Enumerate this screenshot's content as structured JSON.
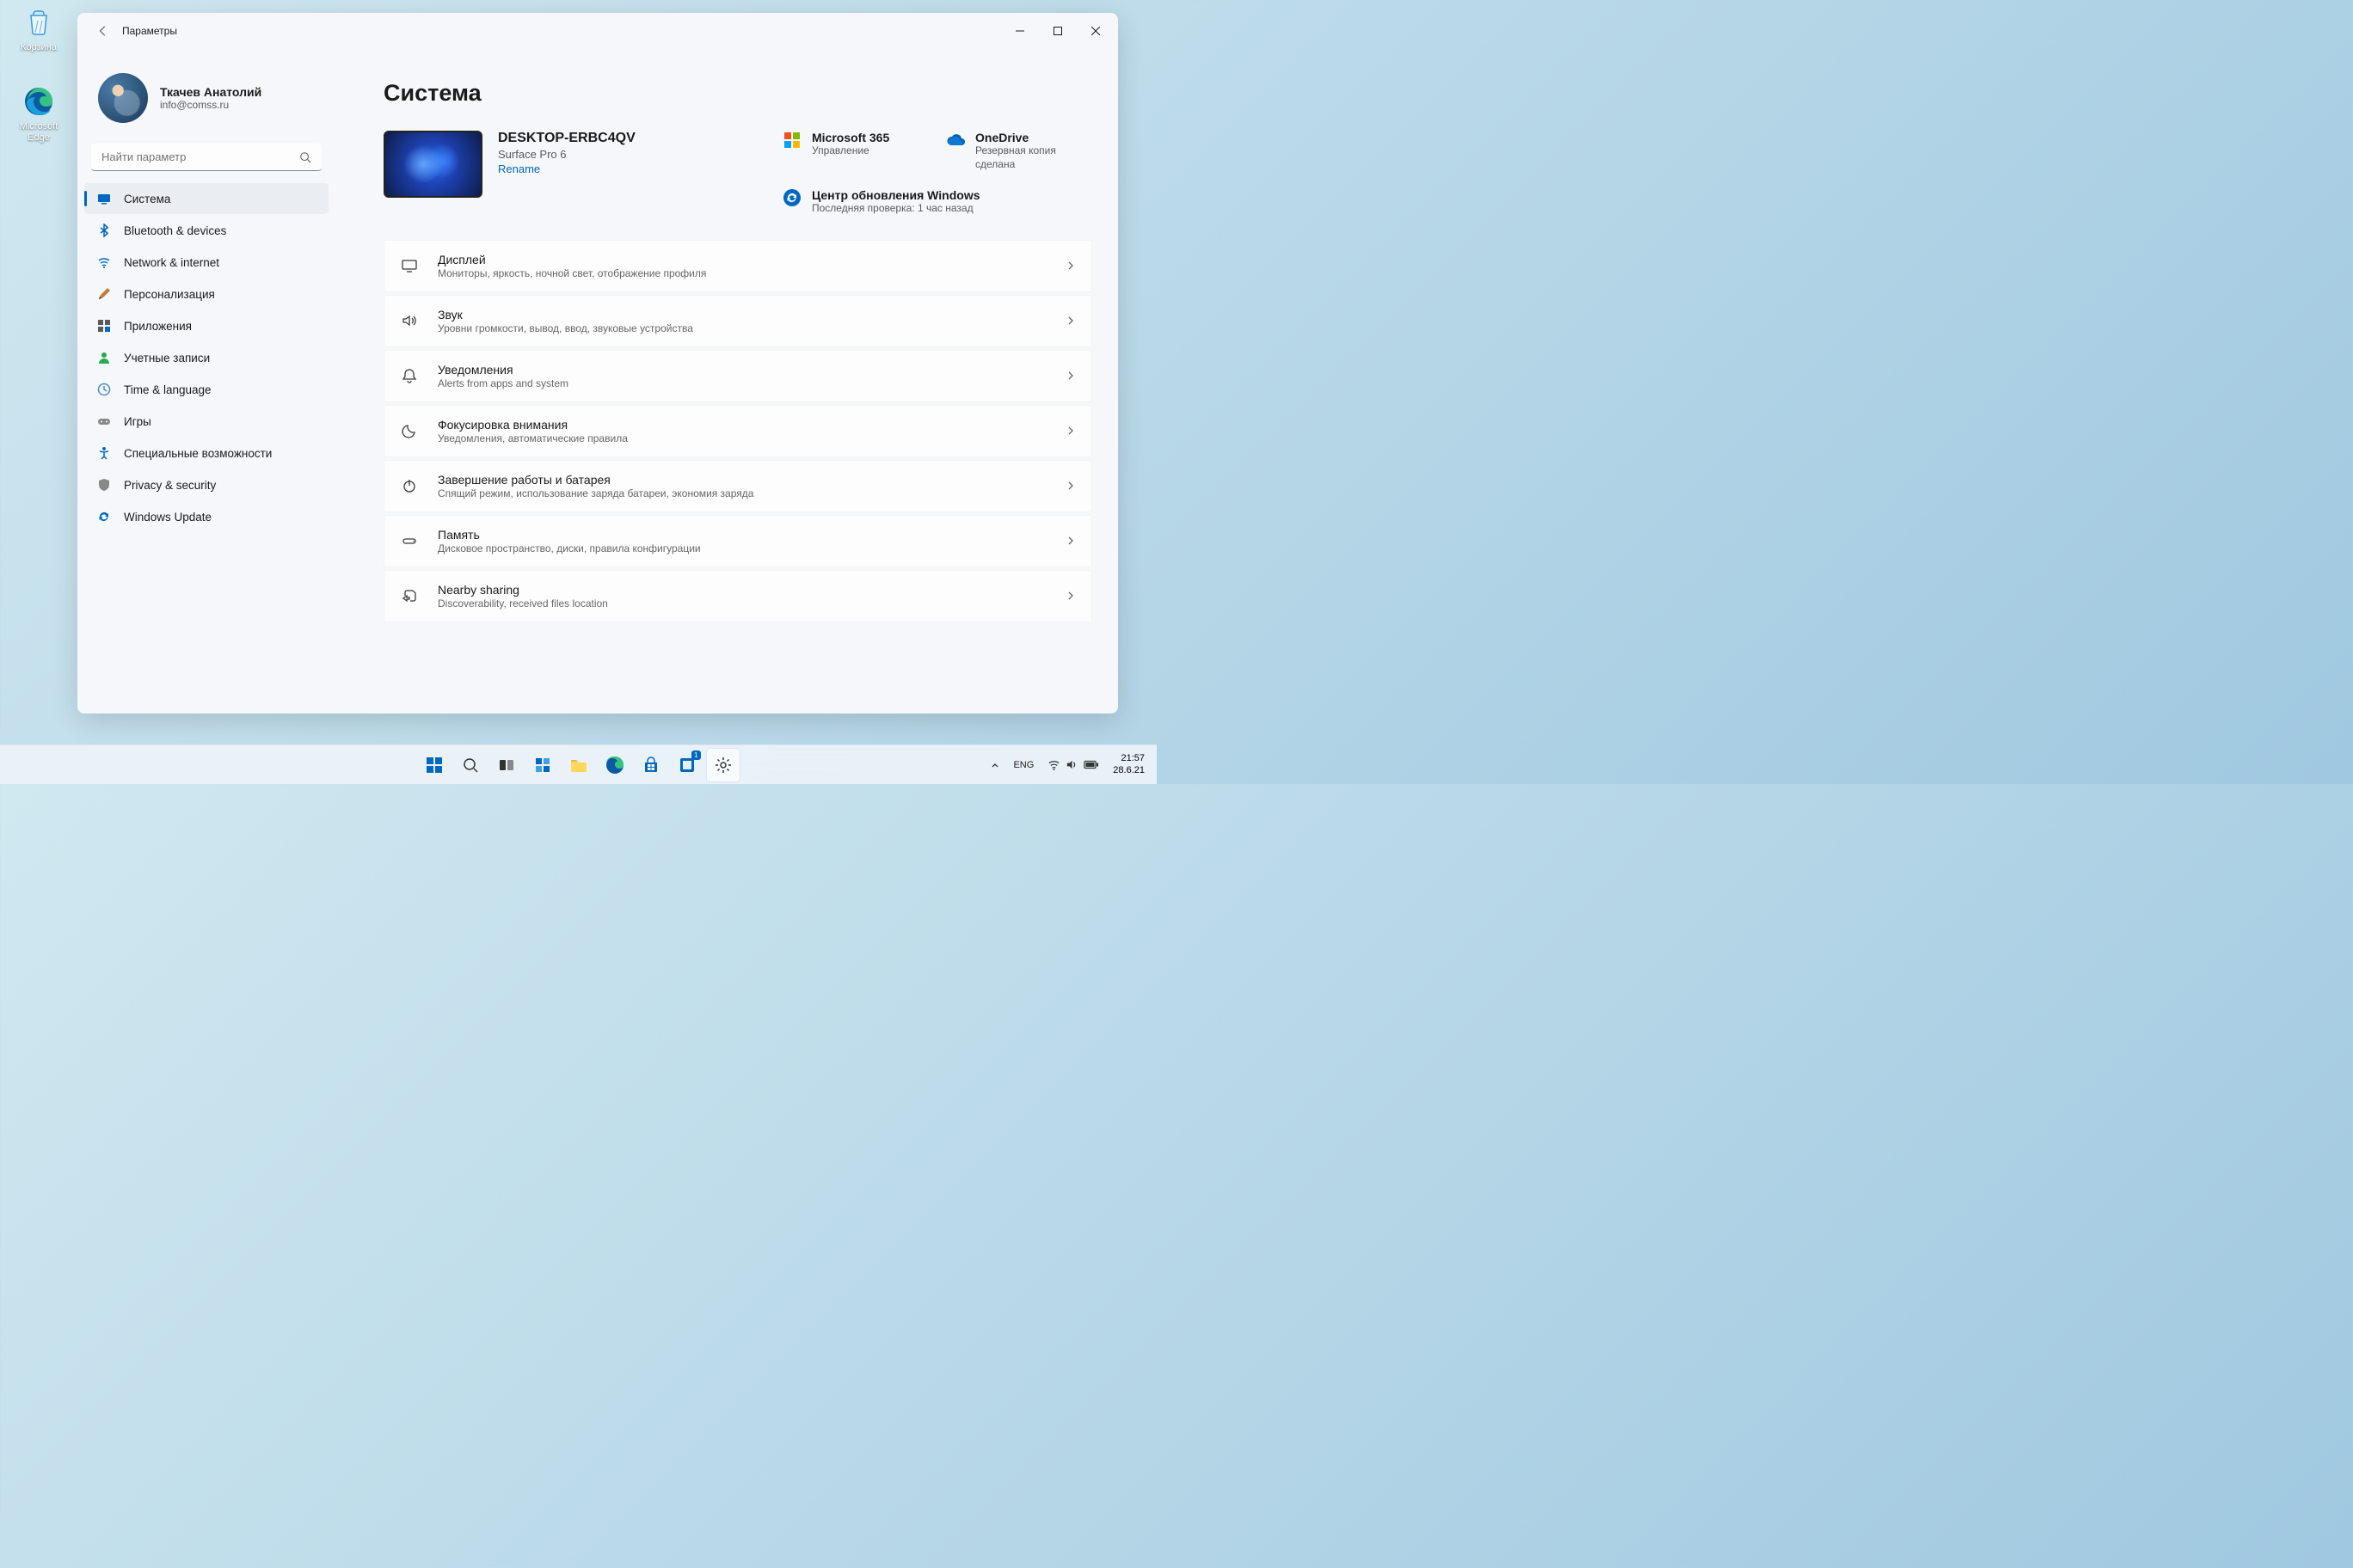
{
  "desktop": {
    "recycle": {
      "label": "Корзина"
    },
    "edge": {
      "label": "Microsoft Edge"
    }
  },
  "window": {
    "title": "Параметры",
    "profile": {
      "name": "Ткачев Анатолий",
      "email": "info@comss.ru"
    },
    "search_placeholder": "Найти параметр",
    "nav": [
      {
        "id": "system",
        "label": "Система"
      },
      {
        "id": "bluetooth",
        "label": "Bluetooth & devices"
      },
      {
        "id": "network",
        "label": "Network & internet"
      },
      {
        "id": "personalization",
        "label": "Персонализация"
      },
      {
        "id": "apps",
        "label": "Приложения"
      },
      {
        "id": "accounts",
        "label": "Учетные записи"
      },
      {
        "id": "time",
        "label": "Time & language"
      },
      {
        "id": "gaming",
        "label": "Игры"
      },
      {
        "id": "accessibility",
        "label": "Специальные возможности"
      },
      {
        "id": "privacy",
        "label": "Privacy & security"
      },
      {
        "id": "update",
        "label": "Windows Update"
      }
    ]
  },
  "main": {
    "heading": "Система",
    "device": {
      "name": "DESKTOP-ERBC4QV",
      "model": "Surface Pro 6",
      "rename": "Rename"
    },
    "cloud": {
      "m365": {
        "title": "Microsoft 365",
        "sub": "Управление"
      },
      "onedrive": {
        "title": "OneDrive",
        "sub": "Резервная копия сделана"
      },
      "update": {
        "title": "Центр обновления Windows",
        "sub": "Последняя проверка: 1 час назад"
      }
    },
    "items": [
      {
        "icon": "display",
        "title": "Дисплей",
        "sub": "Мониторы, яркость, ночной свет, отображение профиля"
      },
      {
        "icon": "sound",
        "title": "Звук",
        "sub": "Уровни громкости, вывод, ввод, звуковые устройства"
      },
      {
        "icon": "notifications",
        "title": "Уведомления",
        "sub": "Alerts from apps and system"
      },
      {
        "icon": "focus",
        "title": "Фокусировка внимания",
        "sub": "Уведомления, автоматические правила"
      },
      {
        "icon": "power",
        "title": "Завершение работы и батарея",
        "sub": "Спящий режим, использование заряда батареи, экономия заряда"
      },
      {
        "icon": "storage",
        "title": "Память",
        "sub": "Дисковое пространство, диски, правила конфигурации"
      },
      {
        "icon": "share",
        "title": "Nearby sharing",
        "sub": "Discoverability, received files location"
      }
    ]
  },
  "taskbar": {
    "lang": "ENG",
    "time": "21:57",
    "date": "28.6.21"
  }
}
